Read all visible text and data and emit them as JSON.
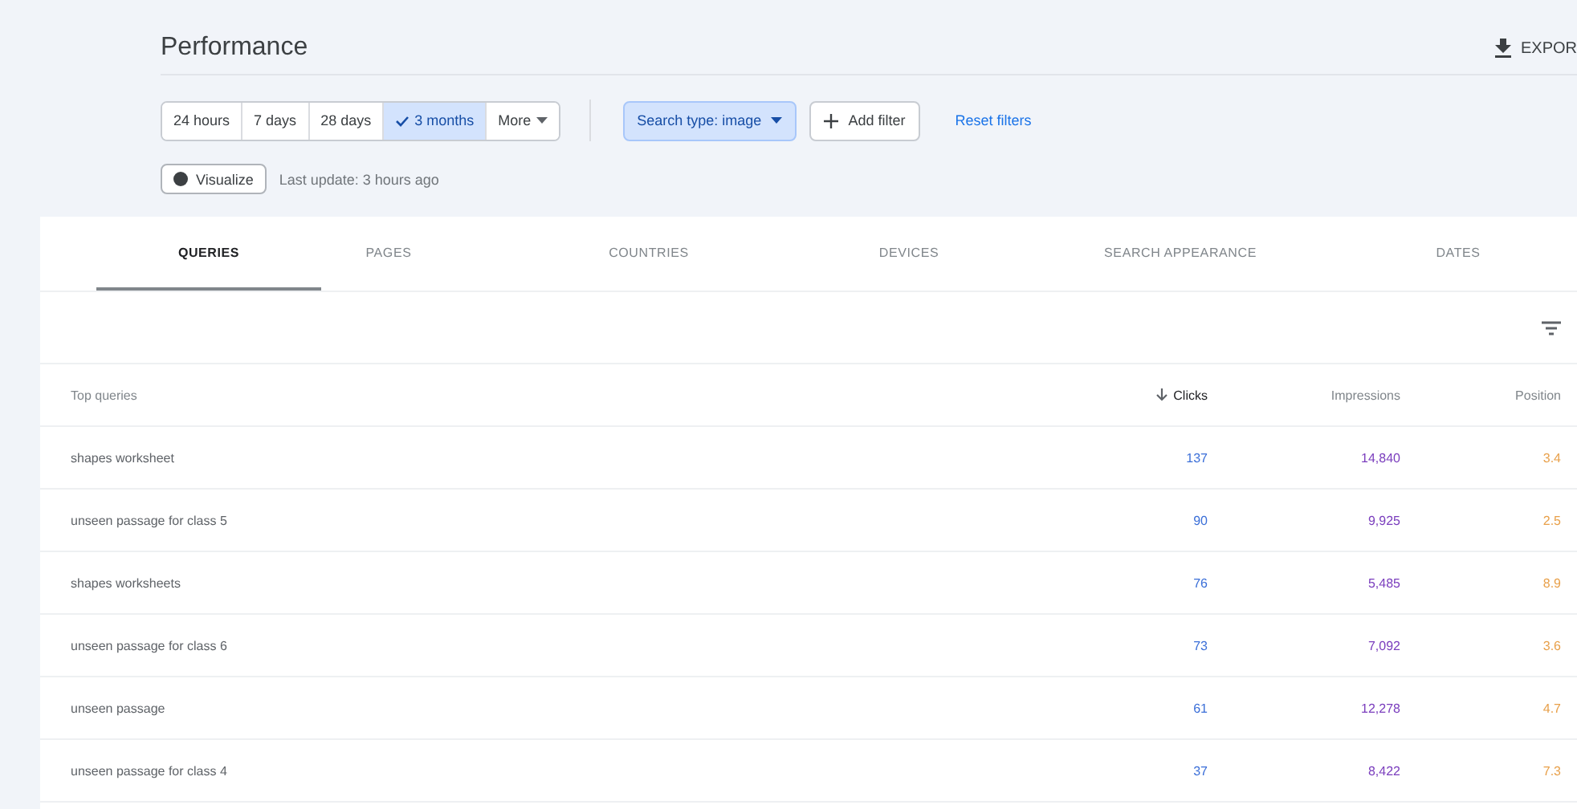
{
  "header": {
    "title": "Performance",
    "export_label": "EXPOR"
  },
  "date_ranges": [
    {
      "label": "24 hours",
      "selected": false
    },
    {
      "label": "7 days",
      "selected": false
    },
    {
      "label": "28 days",
      "selected": false
    },
    {
      "label": "3 months",
      "selected": true
    },
    {
      "label": "More",
      "selected": false
    }
  ],
  "filters": {
    "search_type": "Search type: image",
    "add_filter": "Add filter",
    "reset": "Reset filters"
  },
  "visualize": {
    "label": "Visualize",
    "last_update": "Last update: 3 hours ago"
  },
  "tabs": [
    {
      "label": "QUERIES",
      "selected": true
    },
    {
      "label": "PAGES",
      "selected": false
    },
    {
      "label": "COUNTRIES",
      "selected": false
    },
    {
      "label": "DEVICES",
      "selected": false
    },
    {
      "label": "SEARCH APPEARANCE",
      "selected": false
    },
    {
      "label": "DATES",
      "selected": false
    }
  ],
  "table": {
    "columns": [
      "Top queries",
      "Clicks",
      "Impressions",
      "Position"
    ],
    "rows": [
      [
        "shapes worksheet",
        "137",
        "14,840",
        "3.4"
      ],
      [
        "unseen passage for class 5",
        "90",
        "9,925",
        "2.5"
      ],
      [
        "shapes worksheets",
        "76",
        "5,485",
        "8.9"
      ],
      [
        "unseen passage for class 6",
        "73",
        "7,092",
        "3.6"
      ],
      [
        "unseen passage",
        "61",
        "12,278",
        "4.7"
      ],
      [
        "unseen passage for class 4",
        "37",
        "8,422",
        "7.3"
      ]
    ]
  }
}
